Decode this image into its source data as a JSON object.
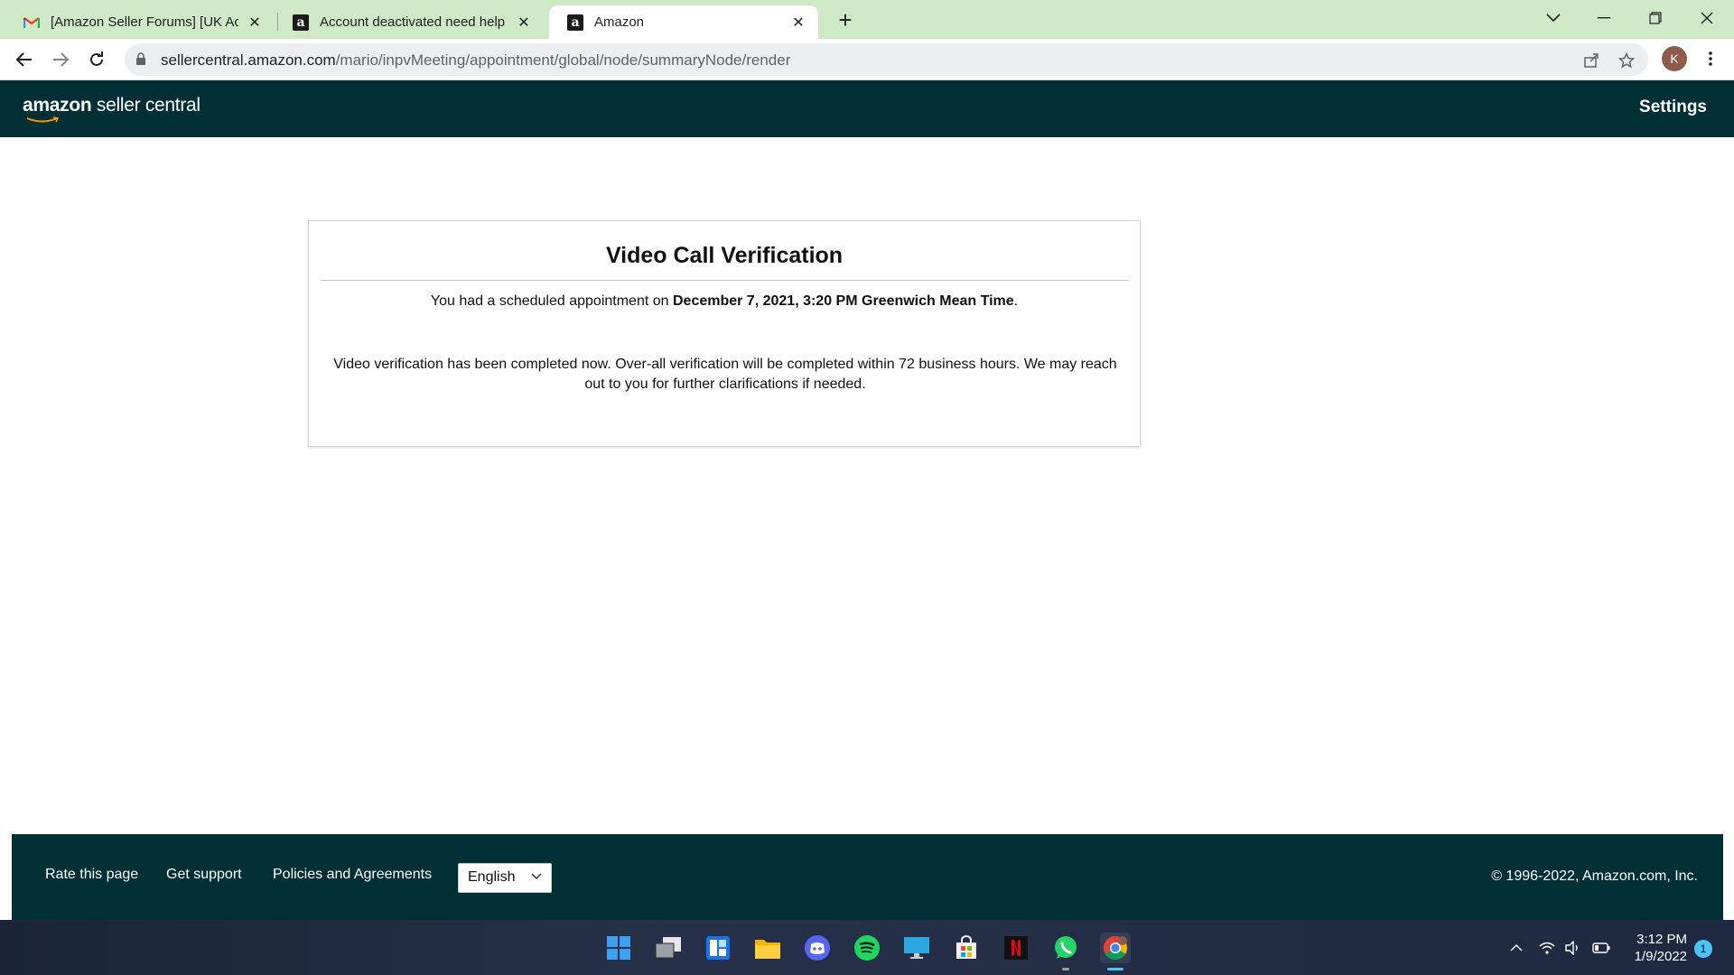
{
  "browser": {
    "tabs": [
      {
        "title": "[Amazon Seller Forums] [UK Acco",
        "icon": "gmail-icon",
        "active": false
      },
      {
        "title": "Account deactivated need help -",
        "icon": "amazon-icon",
        "active": false
      },
      {
        "title": "Amazon",
        "icon": "amazon-icon",
        "active": true
      }
    ],
    "url_host": "sellercentral.amazon.com",
    "url_path": "/mario/inpvMeeting/appointment/global/node/summaryNode/render",
    "profile_initial": "K"
  },
  "header": {
    "logo_bold": "amazon",
    "logo_rest": " seller central",
    "settings_label": "Settings"
  },
  "card": {
    "title": "Video Call Verification",
    "line1_prefix": "You had a scheduled appointment on ",
    "line1_bold": "December 7, 2021, 3:20 PM Greenwich Mean Time",
    "line1_suffix": ".",
    "paragraph": "Video verification has been completed now. Over-all verification will be completed within 72 business hours. We may reach out to you for further clarifications if needed."
  },
  "footer": {
    "rate_label": "Rate this page",
    "support_label": "Get support",
    "policies_label": "Policies and Agreements",
    "language_value": "English",
    "copyright": "© 1996-2022, Amazon.com, Inc."
  },
  "taskbar": {
    "apps": [
      "windows-start-icon",
      "task-view-icon",
      "widgets-icon",
      "file-explorer-icon",
      "discord-icon",
      "spotify-icon",
      "remote-desktop-icon",
      "microsoft-store-icon",
      "netflix-icon",
      "whatsapp-icon",
      "chrome-icon"
    ],
    "time": "3:12 PM",
    "date": "1/9/2022",
    "notification_count": "1"
  },
  "colors": {
    "tabbar_bg": "#cfe8c6",
    "header_bg": "#002f36",
    "spotify": "#1ed760",
    "whatsapp": "#25d366",
    "netflix": "#e50914"
  }
}
